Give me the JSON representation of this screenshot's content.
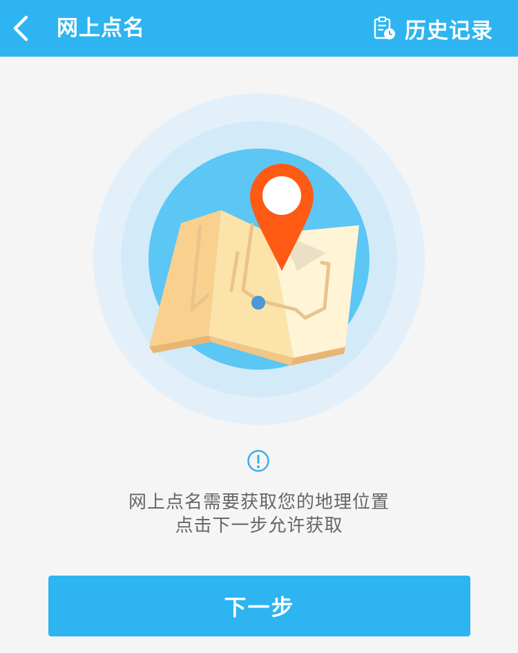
{
  "header": {
    "title": "网上点名",
    "history_label": "历史记录",
    "back_icon": "chevron-left-icon",
    "history_icon": "clipboard-clock-icon",
    "background_color": "#2eb4f0"
  },
  "illustration": {
    "icon": "map-location-pin-icon",
    "accent_color": "#ff5a14"
  },
  "notice": {
    "icon": "exclamation-circle-icon",
    "line1": "网上点名需要获取您的地理位置",
    "line2": "点击下一步允许获取"
  },
  "actions": {
    "next_label": "下一步",
    "button_color": "#2eb4f0"
  }
}
